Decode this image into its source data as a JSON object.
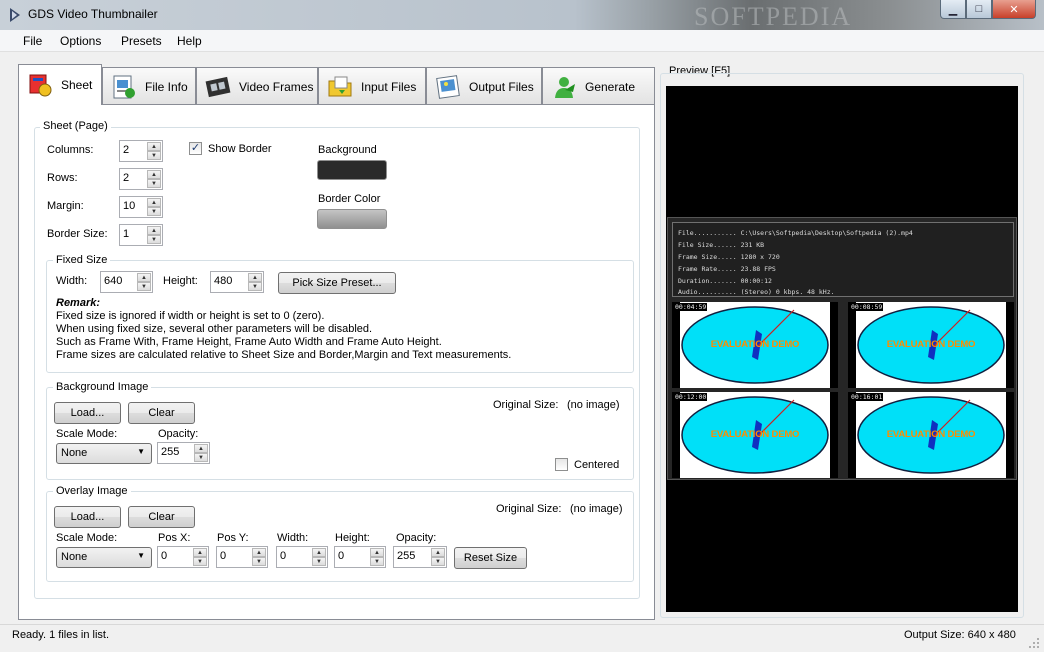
{
  "window": {
    "title": "GDS Video Thumbnailer",
    "minimize": "▁",
    "maximize": "□",
    "close": "✕"
  },
  "menu": [
    "File",
    "Options",
    "Presets",
    "Help"
  ],
  "tabs": [
    {
      "label": "Sheet",
      "icon": "sheet-icon",
      "active": true
    },
    {
      "label": "File Info",
      "icon": "file-info-icon"
    },
    {
      "label": "Video Frames",
      "icon": "film-icon"
    },
    {
      "label": "Input Files",
      "icon": "input-files-icon"
    },
    {
      "label": "Output Files",
      "icon": "output-files-icon"
    },
    {
      "label": "Generate",
      "icon": "generate-icon"
    }
  ],
  "sheet": {
    "group_label": "Sheet (Page)",
    "columns": {
      "label": "Columns:",
      "value": "2"
    },
    "rows": {
      "label": "Rows:",
      "value": "2"
    },
    "margin": {
      "label": "Margin:",
      "value": "10"
    },
    "border_size": {
      "label": "Border Size:",
      "value": "1"
    },
    "show_border": {
      "label": "Show Border",
      "checked": true,
      "mark": "✓"
    },
    "background_label": "Background",
    "border_color_label": "Border Color",
    "background_color": "#2a2a2a",
    "border_color": "#a0a0a0"
  },
  "fixed_size": {
    "group_label": "Fixed Size",
    "width_label": "Width:",
    "width": "640",
    "height_label": "Height:",
    "height": "480",
    "preset_button": "Pick Size Preset...",
    "remark_title": "Remark:",
    "remark_lines": [
      "Fixed size is ignored if width or height is set to 0 (zero).",
      "When using fixed size, several other parameters will be disabled.",
      "Such as Frame With, Frame Height, Frame Auto Width and Frame Auto Height.",
      "Frame sizes are calculated relative to Sheet Size and Border,Margin and Text measurements."
    ]
  },
  "background_image": {
    "group_label": "Background Image",
    "load": "Load...",
    "clear": "Clear",
    "original_size_label": "Original Size:",
    "original_size": "(no image)",
    "scale_mode_label": "Scale Mode:",
    "scale_mode": "None",
    "opacity_label": "Opacity:",
    "opacity": "255",
    "centered_label": "Centered",
    "centered": false
  },
  "overlay_image": {
    "group_label": "Overlay Image",
    "load": "Load...",
    "clear": "Clear",
    "original_size_label": "Original Size:",
    "original_size": "(no image)",
    "scale_mode_label": "Scale Mode:",
    "scale_mode": "None",
    "pos_x_label": "Pos X:",
    "pos_x": "0",
    "pos_y_label": "Pos Y:",
    "pos_y": "0",
    "width_label": "Width:",
    "width": "0",
    "height_label": "Height:",
    "height": "0",
    "opacity_label": "Opacity:",
    "opacity": "255",
    "reset_size": "Reset Size"
  },
  "preview": {
    "label": "Preview  [F5]",
    "info_lines": [
      "File........... C:\\Users\\Softpedia\\Desktop\\Softpedia (2).mp4",
      "File Size...... 231 KB",
      "Frame Size..... 1280 x 720",
      "Frame Rate..... 23.88 FPS",
      "Duration....... 00:00:12",
      "Audio.......... (Stereo) 0 kbps. 48 kHz."
    ],
    "thumbs": [
      {
        "time": "00:04:59",
        "text": "EVALUATION DEMO"
      },
      {
        "time": "00:08:59",
        "text": "EVALUATION DEMO"
      },
      {
        "time": "00:12:00",
        "text": "EVALUATION DEMO"
      },
      {
        "time": "00:16:01",
        "text": "EVALUATION DEMO"
      }
    ]
  },
  "status": {
    "left": "Ready. 1 files in list.",
    "right": "Output Size: 640 x 480"
  },
  "watermark": "SOFTPEDIA"
}
